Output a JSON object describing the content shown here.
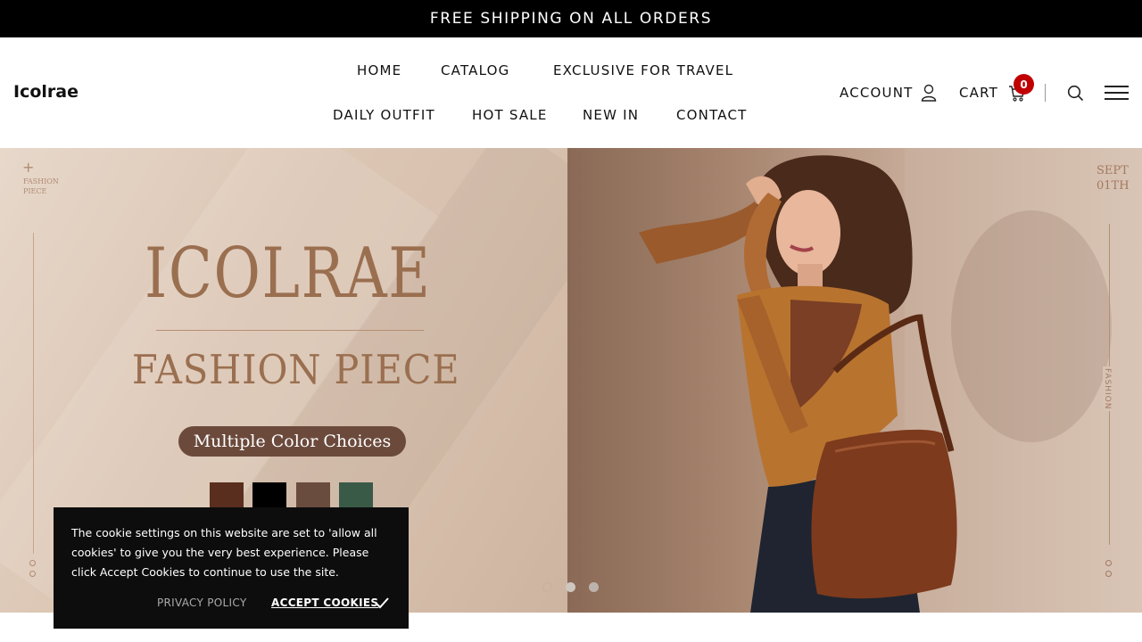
{
  "announcement": {
    "text": "FREE SHIPPING ON ALL ORDERS"
  },
  "header": {
    "logo": "Icolrae",
    "nav_row1": [
      "HOME",
      "CATALOG",
      "EXCLUSIVE FOR TRAVEL"
    ],
    "nav_row2": [
      "DAILY OUTFIT",
      "HOT SALE",
      "NEW IN",
      "CONTACT"
    ],
    "account_label": "ACCOUNT",
    "cart_label": "CART",
    "cart_count": "0",
    "icons": [
      "user-icon",
      "cart-icon",
      "search-icon",
      "menu-icon"
    ]
  },
  "hero": {
    "brand": "ICOLRAE",
    "headline": "FASHION PIECE",
    "pill": "Multiple Color Choices",
    "swatches": [
      "#5a2e1f",
      "#000000",
      "#6a4c3e",
      "#3a5a48"
    ],
    "corner_label_line1": "FASHION",
    "corner_label_line2": "PIECE",
    "date_line1": "SEPT",
    "date_line2": "01TH",
    "side_text": "FASHION",
    "slides_total": 3,
    "active_slide": 2
  },
  "cookie": {
    "message": "The cookie settings on this website are set to 'allow all cookies' to give you the very best experience. Please click Accept Cookies to continue to use the site.",
    "privacy_label": "PRIVACY POLICY",
    "accept_label": "ACCEPT COOKIES"
  },
  "colors": {
    "announcement_bg": "#000000",
    "badge": "#c00000",
    "brand_tan": "#9a6f50",
    "pill_bg": "#6b4a3c"
  }
}
